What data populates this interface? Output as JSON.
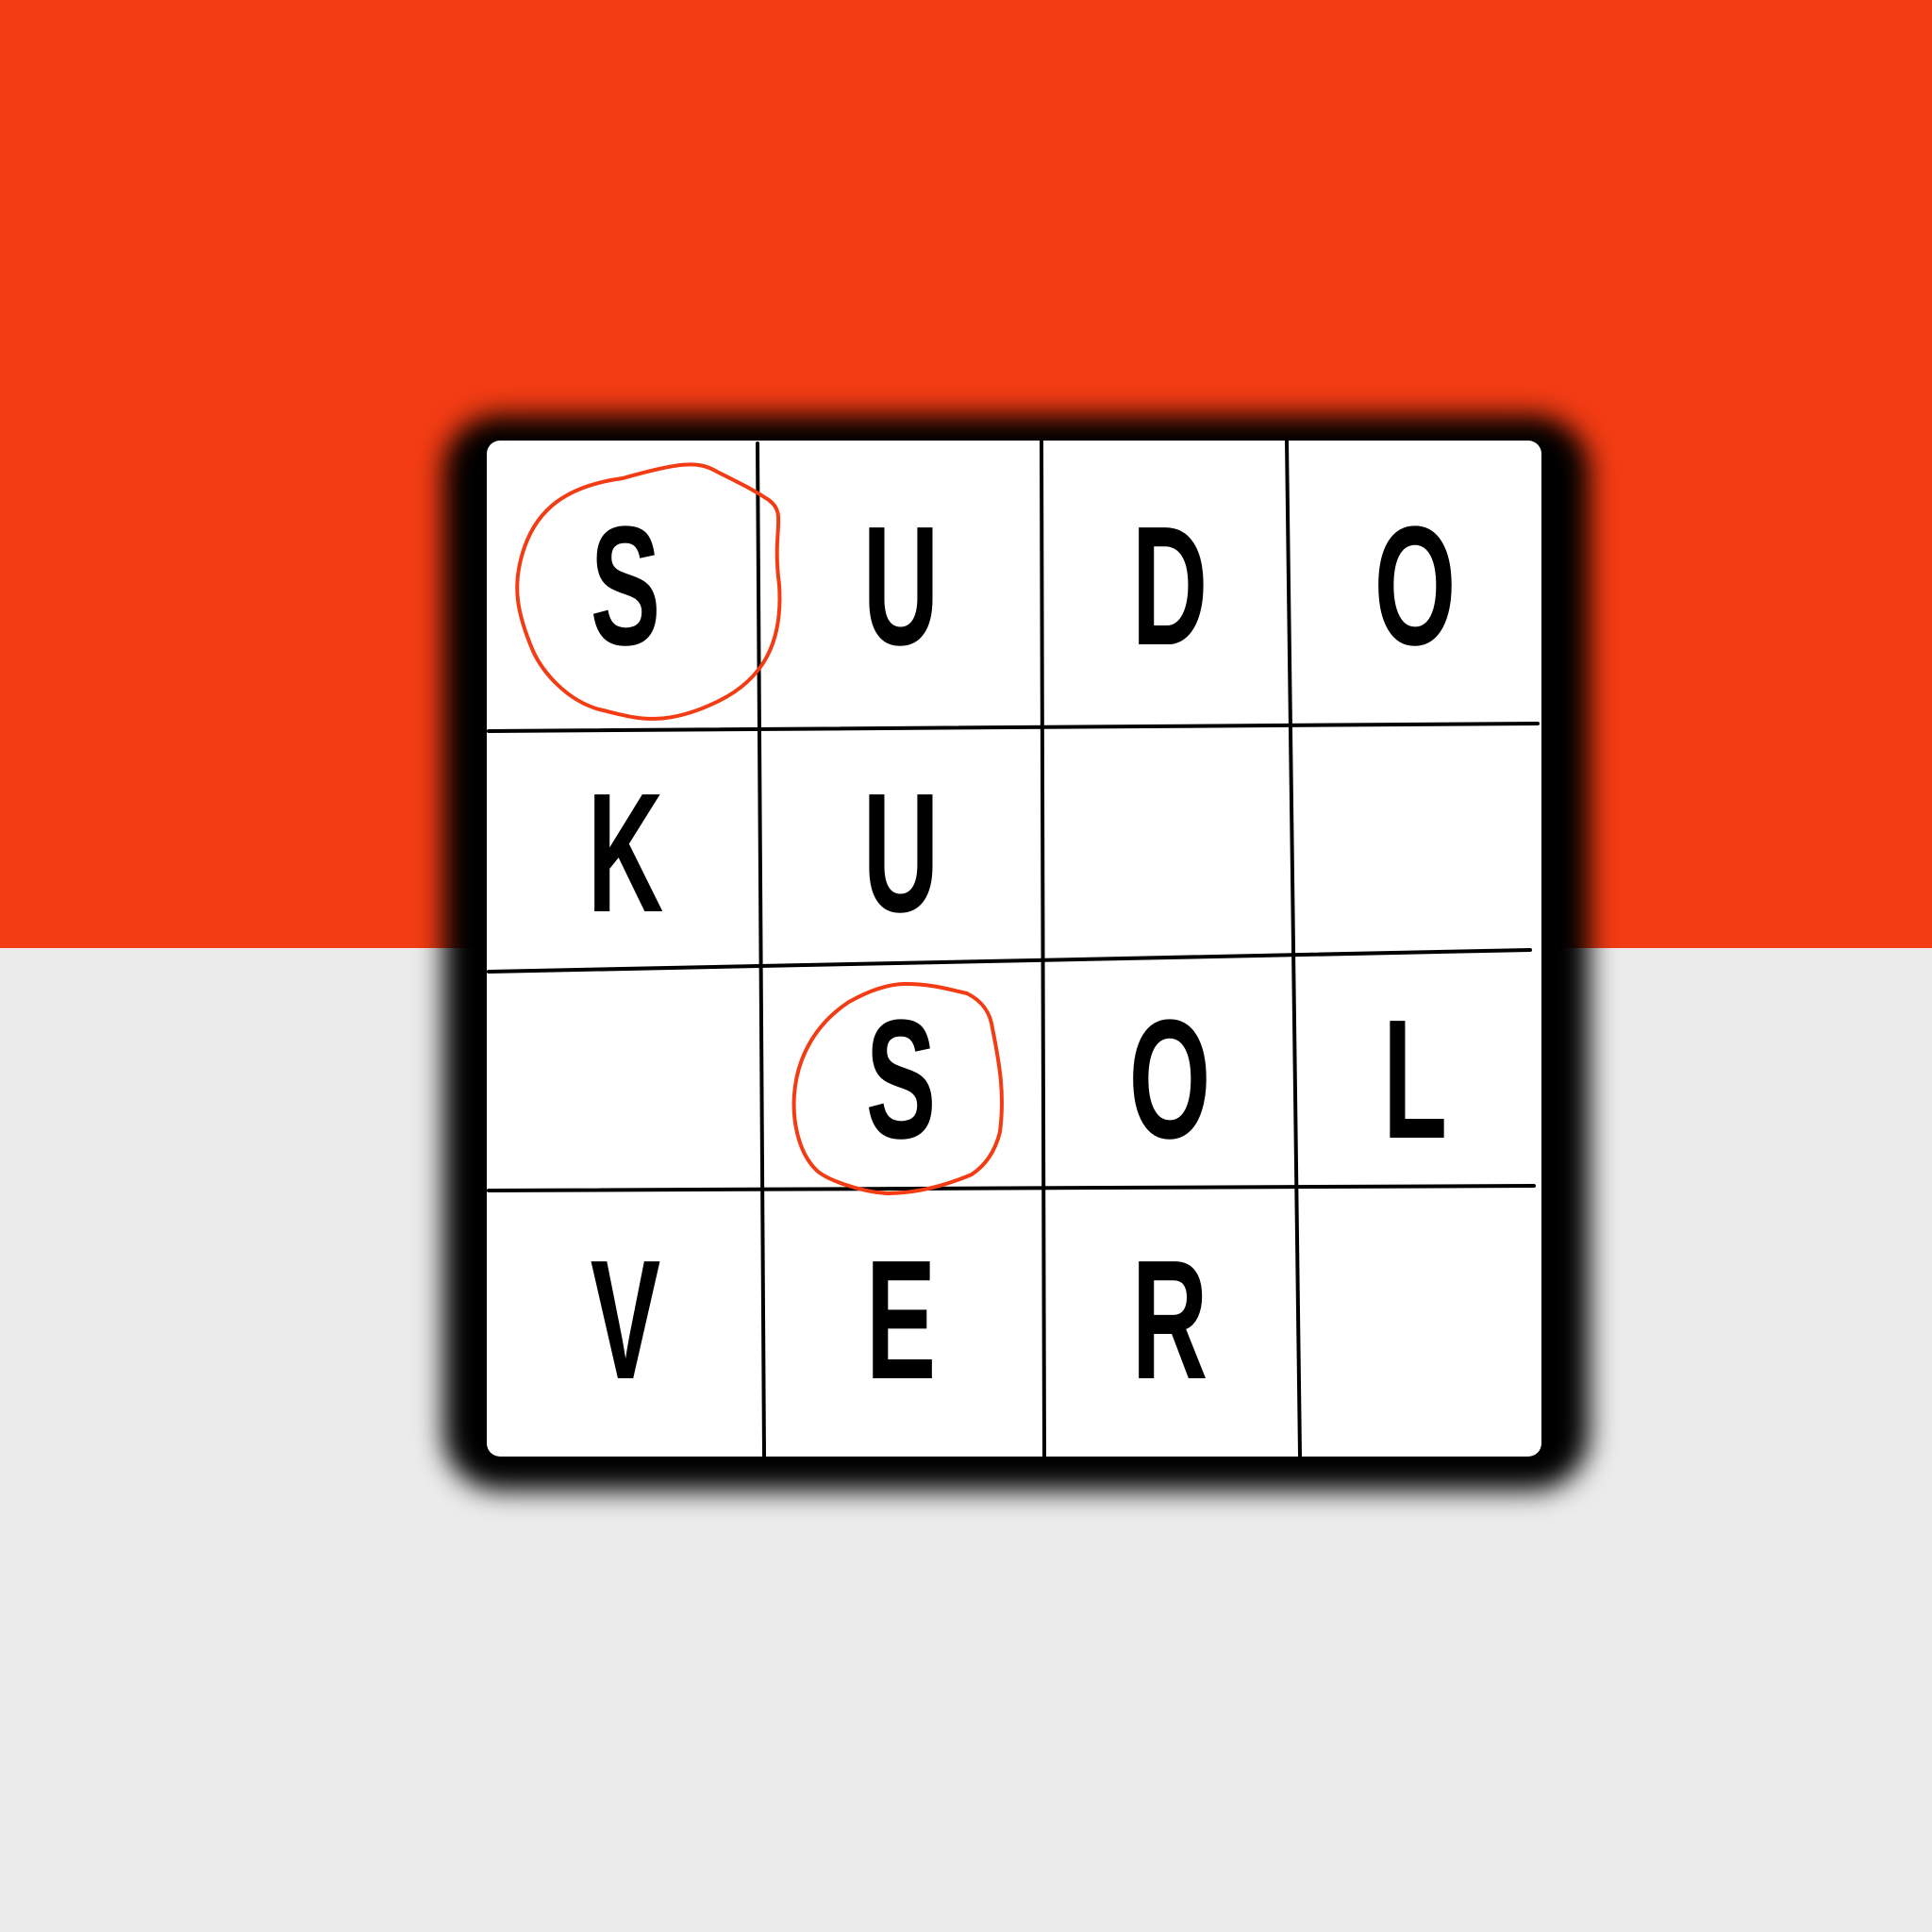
{
  "colors": {
    "top_background": "#f33c14",
    "bottom_background": "#ecebeb",
    "board": "#ffffff",
    "grid_lines": "#000000",
    "letters": "#000000",
    "circle_marks": "#f33c14"
  },
  "logo": {
    "grid": [
      [
        "S",
        "U",
        "D",
        "O"
      ],
      [
        "K",
        "U",
        "",
        ""
      ],
      [
        "",
        "S",
        "O",
        "L"
      ],
      [
        "V",
        "E",
        "R",
        ""
      ]
    ],
    "circled_cells": [
      "r0c0",
      "r2c1"
    ]
  },
  "icons": [
    "hand-drawn-circle-icon"
  ]
}
